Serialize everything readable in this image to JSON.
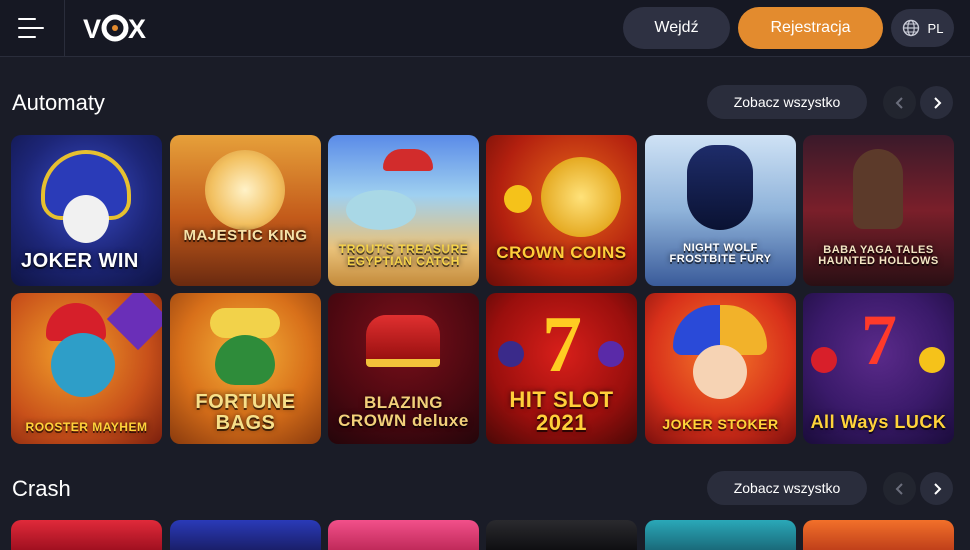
{
  "header": {
    "logo_text": "VOX",
    "login_label": "Wejdź",
    "register_label": "Rejestracja",
    "language": "PL"
  },
  "colors": {
    "accent": "#e38b2e",
    "background": "#1a1c27",
    "header": "#161823",
    "button_dark": "#2e3142"
  },
  "sections": [
    {
      "title": "Automaty",
      "see_all_label": "Zobacz wszystko",
      "games": [
        {
          "name": "JOKER WIN"
        },
        {
          "name": "MAJESTIC KING"
        },
        {
          "name": "TROUT'S TREASURE EGYPTIAN CATCH"
        },
        {
          "name": "CROWN COINS"
        },
        {
          "name": "NIGHT WOLF FROSTBITE FURY"
        },
        {
          "name": "BABA YAGA TALES HAUNTED HOLLOWS"
        },
        {
          "name": "ROOSTER MAYHEM"
        },
        {
          "name": "FORTUNE BAGS"
        },
        {
          "name": "BLAZING CROWN deluxe"
        },
        {
          "name": "HIT SLOT 2021"
        },
        {
          "name": "JOKER STOKER"
        },
        {
          "name": "All Ways LUCK"
        }
      ]
    },
    {
      "title": "Crash",
      "see_all_label": "Zobacz wszystko"
    }
  ],
  "icons": [
    "menu-icon",
    "globe-icon",
    "chevron-left-icon",
    "chevron-right-icon"
  ]
}
